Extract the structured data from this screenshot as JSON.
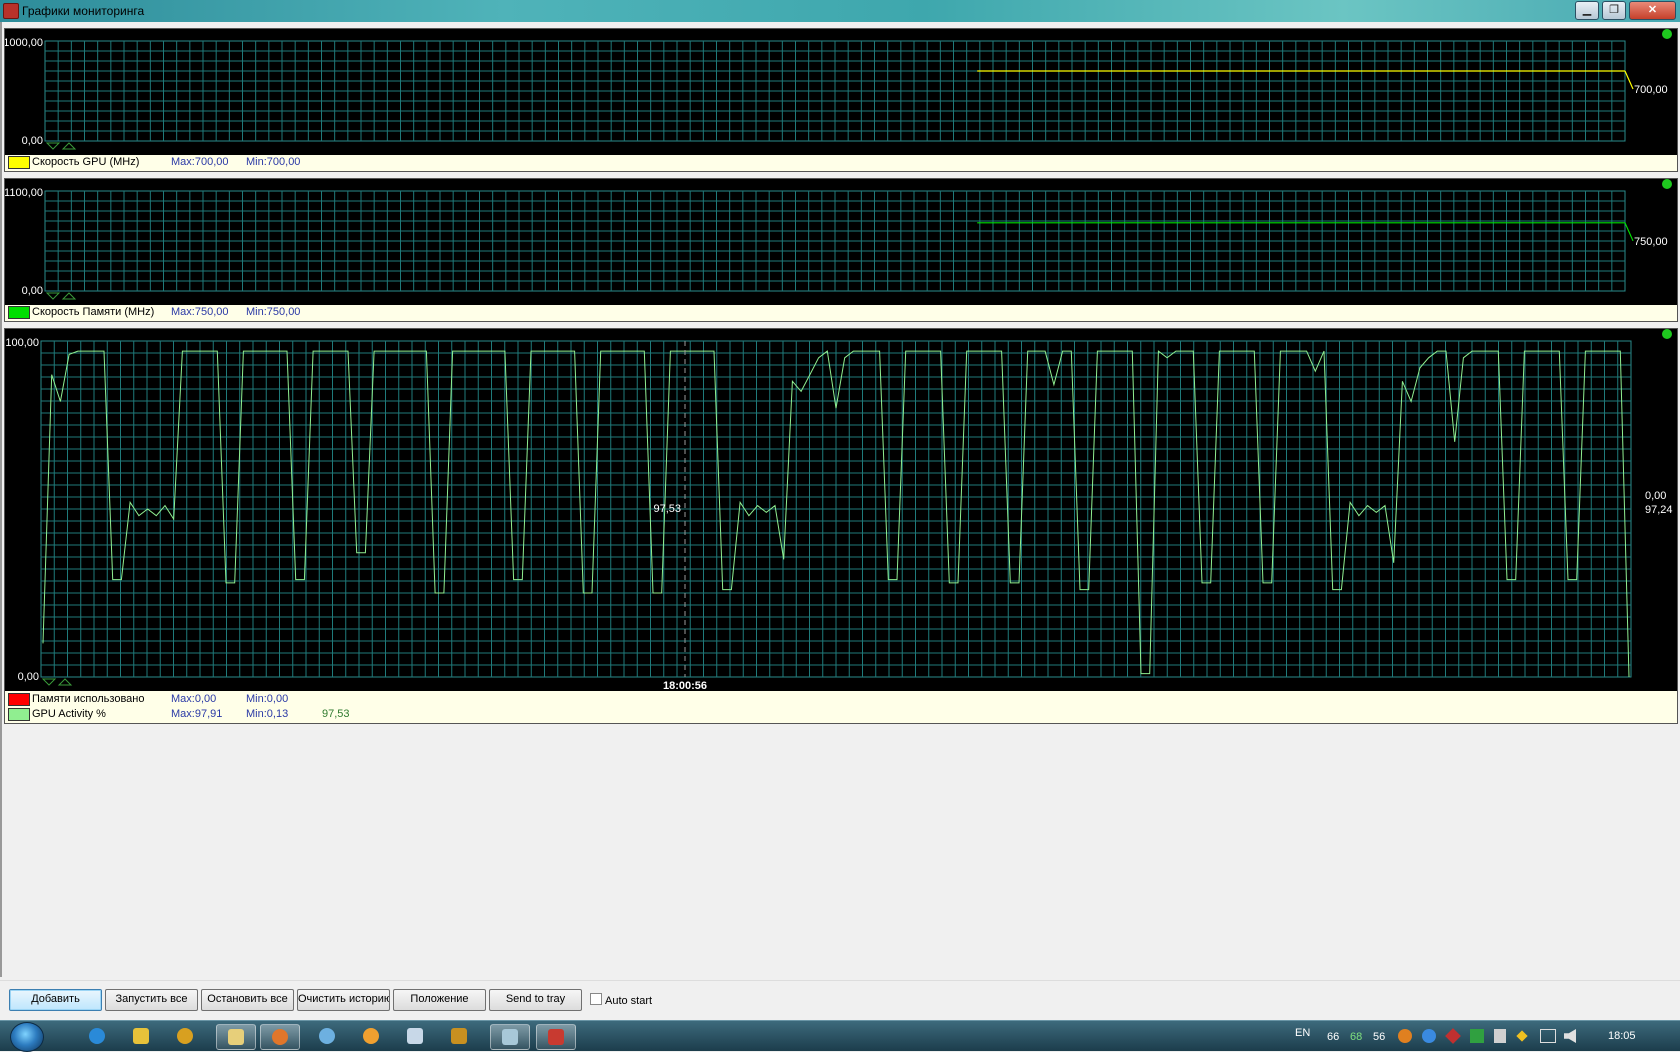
{
  "window": {
    "title": "Графики мониторинга",
    "minimize": "▁",
    "maximize": "❐",
    "close": "✕"
  },
  "panels": [
    {
      "id": "gpu-speed",
      "ymax_label": "1000,00",
      "ymin_label": "0,00",
      "right_label": "700,00",
      "right_label_color": "#e8e870",
      "legend": [
        {
          "color": "#ffff00",
          "name": "Скорость GPU (MHz)",
          "max": "Max:700,00",
          "min": "Min:700,00",
          "current": ""
        }
      ]
    },
    {
      "id": "mem-speed",
      "ymax_label": "1100,00",
      "ymin_label": "0,00",
      "right_label": "750,00",
      "right_label_color": "#7fe07f",
      "legend": [
        {
          "color": "#00e000",
          "name": "Скорость Памяти (MHz)",
          "max": "Max:750,00",
          "min": "Min:750,00",
          "current": ""
        }
      ]
    },
    {
      "id": "gpu-activity",
      "ymax_label": "100,00",
      "ymin_label": "0,00",
      "right_label_top": "0,00",
      "right_label_top_color": "#e02020",
      "right_label": "97,24",
      "right_label_color": "#a0e0a0",
      "cursor_value": "97,53",
      "cursor_time": "18:00:56",
      "legend": [
        {
          "color": "#ff0000",
          "name": "Памяти использовано",
          "max": "Max:0,00",
          "min": "Min:0,00",
          "current": ""
        },
        {
          "color": "#90ee90",
          "name": "GPU Activity %",
          "max": "Max:97,91",
          "min": "Min:0,13",
          "current": "97,53"
        }
      ]
    }
  ],
  "chart_data": [
    {
      "type": "line",
      "title": "",
      "xlabel": "",
      "ylabel": "",
      "ylim": [
        0,
        1000
      ],
      "series": [
        {
          "name": "Скорость GPU (MHz)",
          "color": "#ffff00",
          "x": [
            0.59,
            1.0
          ],
          "values": [
            700,
            700
          ]
        }
      ]
    },
    {
      "type": "line",
      "title": "",
      "xlabel": "",
      "ylabel": "",
      "ylim": [
        0,
        1100
      ],
      "series": [
        {
          "name": "Скорость Памяти (MHz)",
          "color": "#00e000",
          "x": [
            0.59,
            1.0
          ],
          "values": [
            750,
            750
          ]
        }
      ]
    },
    {
      "type": "line",
      "title": "",
      "xlabel": "",
      "ylabel": "",
      "ylim": [
        0,
        100
      ],
      "x_marker": "18:00:56",
      "series": [
        {
          "name": "Памяти использовано",
          "color": "#ff0000",
          "values": [
            0
          ]
        },
        {
          "name": "GPU Activity %",
          "color": "#90ee90",
          "values": [
            10,
            90,
            82,
            96,
            97,
            97,
            97,
            97,
            29,
            29,
            52,
            48,
            50,
            48,
            51,
            47,
            97,
            97,
            97,
            97,
            97,
            28,
            28,
            97,
            97,
            97,
            97,
            97,
            97,
            29,
            29,
            97,
            97,
            97,
            97,
            97,
            37,
            37,
            97,
            97,
            97,
            97,
            97,
            97,
            97,
            25,
            25,
            97,
            97,
            97,
            97,
            97,
            97,
            97,
            29,
            29,
            97,
            97,
            97,
            97,
            97,
            97,
            25,
            25,
            97,
            97,
            97,
            97,
            97,
            97,
            25,
            25,
            97,
            97,
            97,
            97,
            97,
            97,
            26,
            26,
            52,
            48,
            51,
            49,
            51,
            35,
            88,
            85,
            90,
            95,
            97,
            80,
            95,
            97,
            97,
            97,
            97,
            29,
            29,
            97,
            97,
            97,
            97,
            97,
            28,
            28,
            97,
            97,
            97,
            97,
            97,
            28,
            28,
            97,
            97,
            97,
            87,
            97,
            97,
            26,
            26,
            97,
            97,
            97,
            97,
            97,
            1,
            1,
            97,
            95,
            97,
            97,
            97,
            28,
            28,
            97,
            97,
            97,
            97,
            97,
            28,
            28,
            97,
            97,
            97,
            97,
            91,
            97,
            26,
            26,
            52,
            48,
            51,
            49,
            51,
            34,
            88,
            82,
            92,
            95,
            97,
            97,
            70,
            95,
            97,
            97,
            97,
            97,
            29,
            29,
            97,
            97,
            97,
            97,
            97,
            29,
            29,
            97,
            97,
            97,
            97,
            97,
            0
          ]
        }
      ]
    }
  ],
  "toolbar": {
    "add": "Добавить",
    "start_all": "Запустить все",
    "stop_all": "Остановить все",
    "clear_history": "Очистить историю",
    "position": "Положение",
    "send_to_tray": "Send to tray",
    "auto_start": "Auto start"
  },
  "taskbar": {
    "language": "EN",
    "temp1": "66",
    "temp2": "68",
    "temp3": "56",
    "clock": "18:05"
  }
}
